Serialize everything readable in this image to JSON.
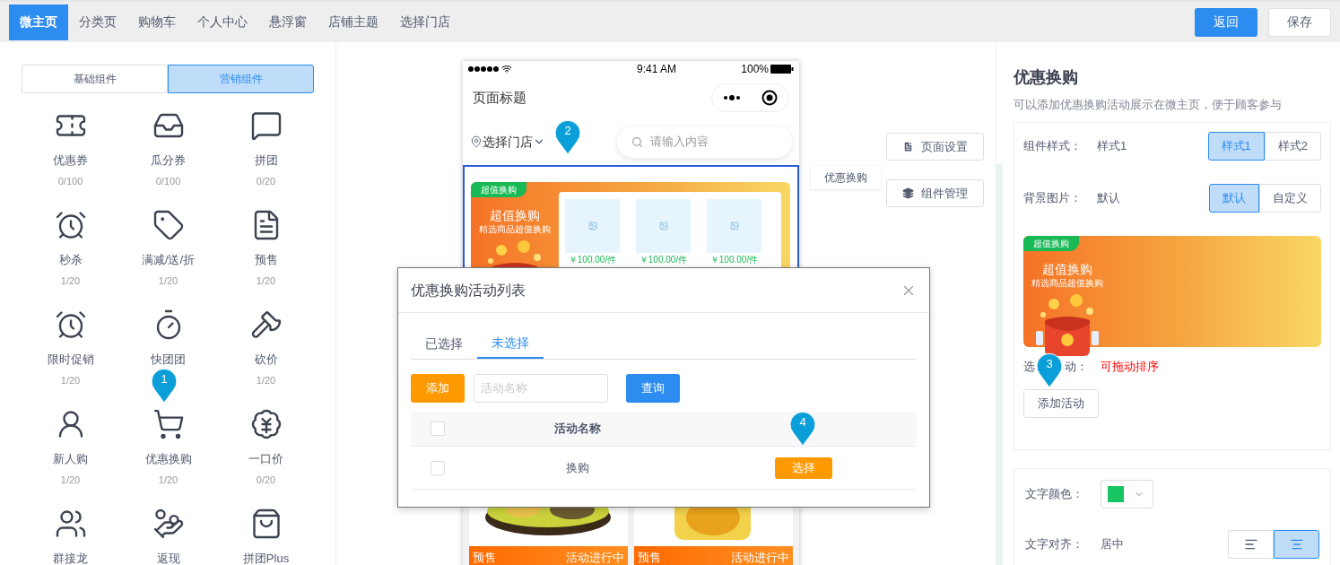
{
  "top_tabs": [
    {
      "label": "微主页",
      "selected": true
    },
    {
      "label": "分类页",
      "selected": false
    },
    {
      "label": "购物车",
      "selected": false
    },
    {
      "label": "个人中心",
      "selected": false
    },
    {
      "label": "悬浮窗",
      "selected": false
    },
    {
      "label": "店铺主题",
      "selected": false
    },
    {
      "label": "选择门店",
      "selected": false
    }
  ],
  "top_buttons": [
    {
      "label": "返回",
      "kind": "primary"
    },
    {
      "label": "保存",
      "kind": "default"
    }
  ],
  "component_tabs": [
    {
      "label": "基础组件",
      "selected": false
    },
    {
      "label": "营销组件",
      "selected": true
    }
  ],
  "components": [
    {
      "name": "优惠券",
      "count": "0/100"
    },
    {
      "name": "瓜分券",
      "count": "0/100"
    },
    {
      "name": "拼团",
      "count": "0/20"
    },
    {
      "name": "秒杀",
      "count": "1/20"
    },
    {
      "name": "满减/送/折",
      "count": "1/20"
    },
    {
      "name": "预售",
      "count": "1/20"
    },
    {
      "name": "限时促销",
      "count": "1/20"
    },
    {
      "name": "快团团"
    },
    {
      "name": "砍价",
      "count": "1/20"
    },
    {
      "name": "新人购",
      "count": "1/20"
    },
    {
      "name": "优惠换购",
      "count": "1/20"
    },
    {
      "name": "一口价",
      "count": "0/20"
    },
    {
      "name": "群接龙"
    },
    {
      "name": "返现"
    },
    {
      "name": "拼团Plus"
    }
  ],
  "phone": {
    "time": "9:41 AM",
    "battery": "100%",
    "title": "页面标题",
    "store": "选择门店",
    "search_placeholder": "请输入内容",
    "banner": {
      "tag": "超值换购",
      "title": "超值换购",
      "subtitle": "精选商品超值换购",
      "prices": [
        "￥100.00/件",
        "￥100.00/件",
        "￥100.00/件"
      ]
    },
    "products": [
      {
        "tag": "预售",
        "status": "活动进行中"
      },
      {
        "tag": "预售",
        "status": "活动进行中"
      }
    ]
  },
  "component_label": "优惠换购",
  "side_buttons": [
    {
      "label": "页面设置",
      "kind": "page"
    },
    {
      "label": "组件管理",
      "kind": "layers"
    }
  ],
  "dialog": {
    "title": "优惠换购活动列表",
    "tabs": [
      {
        "label": "已选择",
        "selected": false
      },
      {
        "label": "未选择",
        "selected": true
      }
    ],
    "add_button": "添加",
    "search_placeholder": "活动名称",
    "query_button": "查询",
    "header_checked": false,
    "column": "活动名称",
    "rows": [
      {
        "name": "换购",
        "checked": false,
        "action": "选择"
      }
    ]
  },
  "settings": {
    "title": "优惠换购",
    "description": "可以添加优惠换购活动展示在微主页，便于顾客参与",
    "rows": [
      {
        "label": "组件样式：",
        "value": "样式1",
        "options": [
          {
            "label": "样式1",
            "selected": true
          },
          {
            "label": "样式2",
            "selected": false
          }
        ]
      },
      {
        "label": "背景图片：",
        "value": "默认",
        "options": [
          {
            "label": "默认",
            "selected": true
          },
          {
            "label": "自定义",
            "selected": false
          }
        ]
      }
    ],
    "preview": {
      "tag": "超值换购",
      "title": "超值换购",
      "subtitle": "精选商品超值换购"
    },
    "activity_label_parts": [
      "选",
      "动："
    ],
    "activity_hint": "可拖动排序",
    "add_button": "添加活动",
    "text_color": {
      "label": "文字颜色：",
      "color": "#19c463"
    },
    "text_align": {
      "label": "文字对齐：",
      "value": "居中",
      "options": [
        {
          "kind": "left",
          "selected": false
        },
        {
          "kind": "center",
          "selected": true
        }
      ]
    }
  },
  "markers": [
    "1",
    "2",
    "3",
    "4"
  ]
}
